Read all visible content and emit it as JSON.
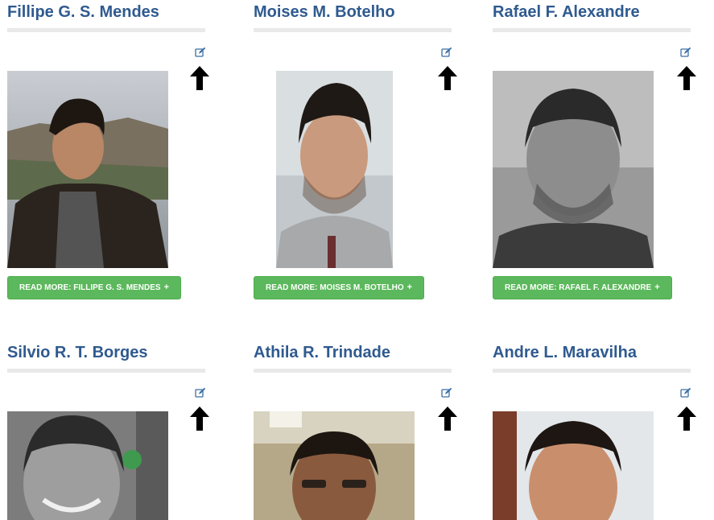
{
  "colors": {
    "name": "#2f5a8f",
    "button": "#5cb85c",
    "divider": "#e9e9e9",
    "edit_icon": "#3a6ea5"
  },
  "icons": {
    "edit": "edit-pencil-square-icon",
    "upload": "up-arrow-icon",
    "plus": "+"
  },
  "people": [
    {
      "name": "Fillipe G. S. Mendes",
      "button_label": "READ MORE: FILLIPE G. S. MENDES",
      "photo": "color-outdoor-portrait"
    },
    {
      "name": "Moises M. Botelho",
      "button_label": "READ MORE: MOISES M. BOTELHO",
      "photo": "color-indoor-portrait"
    },
    {
      "name": "Rafael F. Alexandre",
      "button_label": "READ MORE: RAFAEL F. ALEXANDRE",
      "photo": "grayscale-portrait"
    },
    {
      "name": "Silvio R. T. Borges",
      "photo": "grayscale-portrait"
    },
    {
      "name": "Athila R. Trindade",
      "photo": "color-indoor-portrait"
    },
    {
      "name": "Andre L. Maravilha",
      "photo": "color-indoor-portrait"
    }
  ]
}
